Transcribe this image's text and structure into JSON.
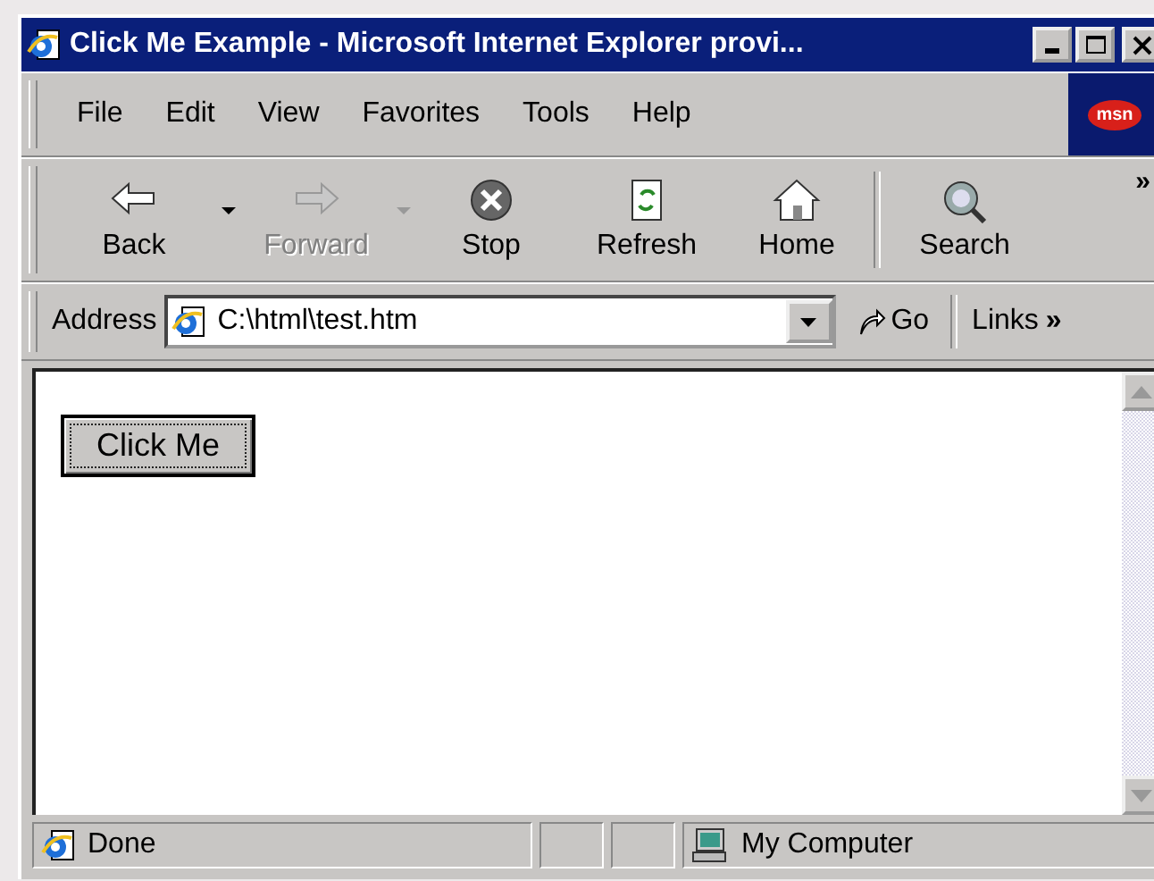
{
  "window": {
    "title": "Click Me Example - Microsoft Internet Explorer provi..."
  },
  "menu": [
    {
      "label": "File"
    },
    {
      "label": "Edit"
    },
    {
      "label": "View"
    },
    {
      "label": "Favorites"
    },
    {
      "label": "Tools"
    },
    {
      "label": "Help"
    }
  ],
  "logo": "msn",
  "toolbar": [
    {
      "kind": "back",
      "label": "Back",
      "disabled": false,
      "dropdown": true
    },
    {
      "kind": "forward",
      "label": "Forward",
      "disabled": true,
      "dropdown": true
    },
    {
      "kind": "stop",
      "label": "Stop",
      "disabled": false,
      "dropdown": false
    },
    {
      "kind": "refresh",
      "label": "Refresh",
      "disabled": false,
      "dropdown": false
    },
    {
      "kind": "home",
      "label": "Home",
      "disabled": false,
      "dropdown": false
    },
    {
      "kind": "separator"
    },
    {
      "kind": "search",
      "label": "Search",
      "disabled": false,
      "dropdown": false
    }
  ],
  "toolbar_overflow": "»",
  "address": {
    "label": "Address",
    "value": "C:\\html\\test.htm"
  },
  "go": "Go",
  "links": {
    "label": "Links",
    "overflow": "»"
  },
  "page": {
    "button": {
      "label": "Click Me",
      "focused": true
    }
  },
  "status_bar": {
    "text": "Done",
    "zone": "My Computer"
  }
}
